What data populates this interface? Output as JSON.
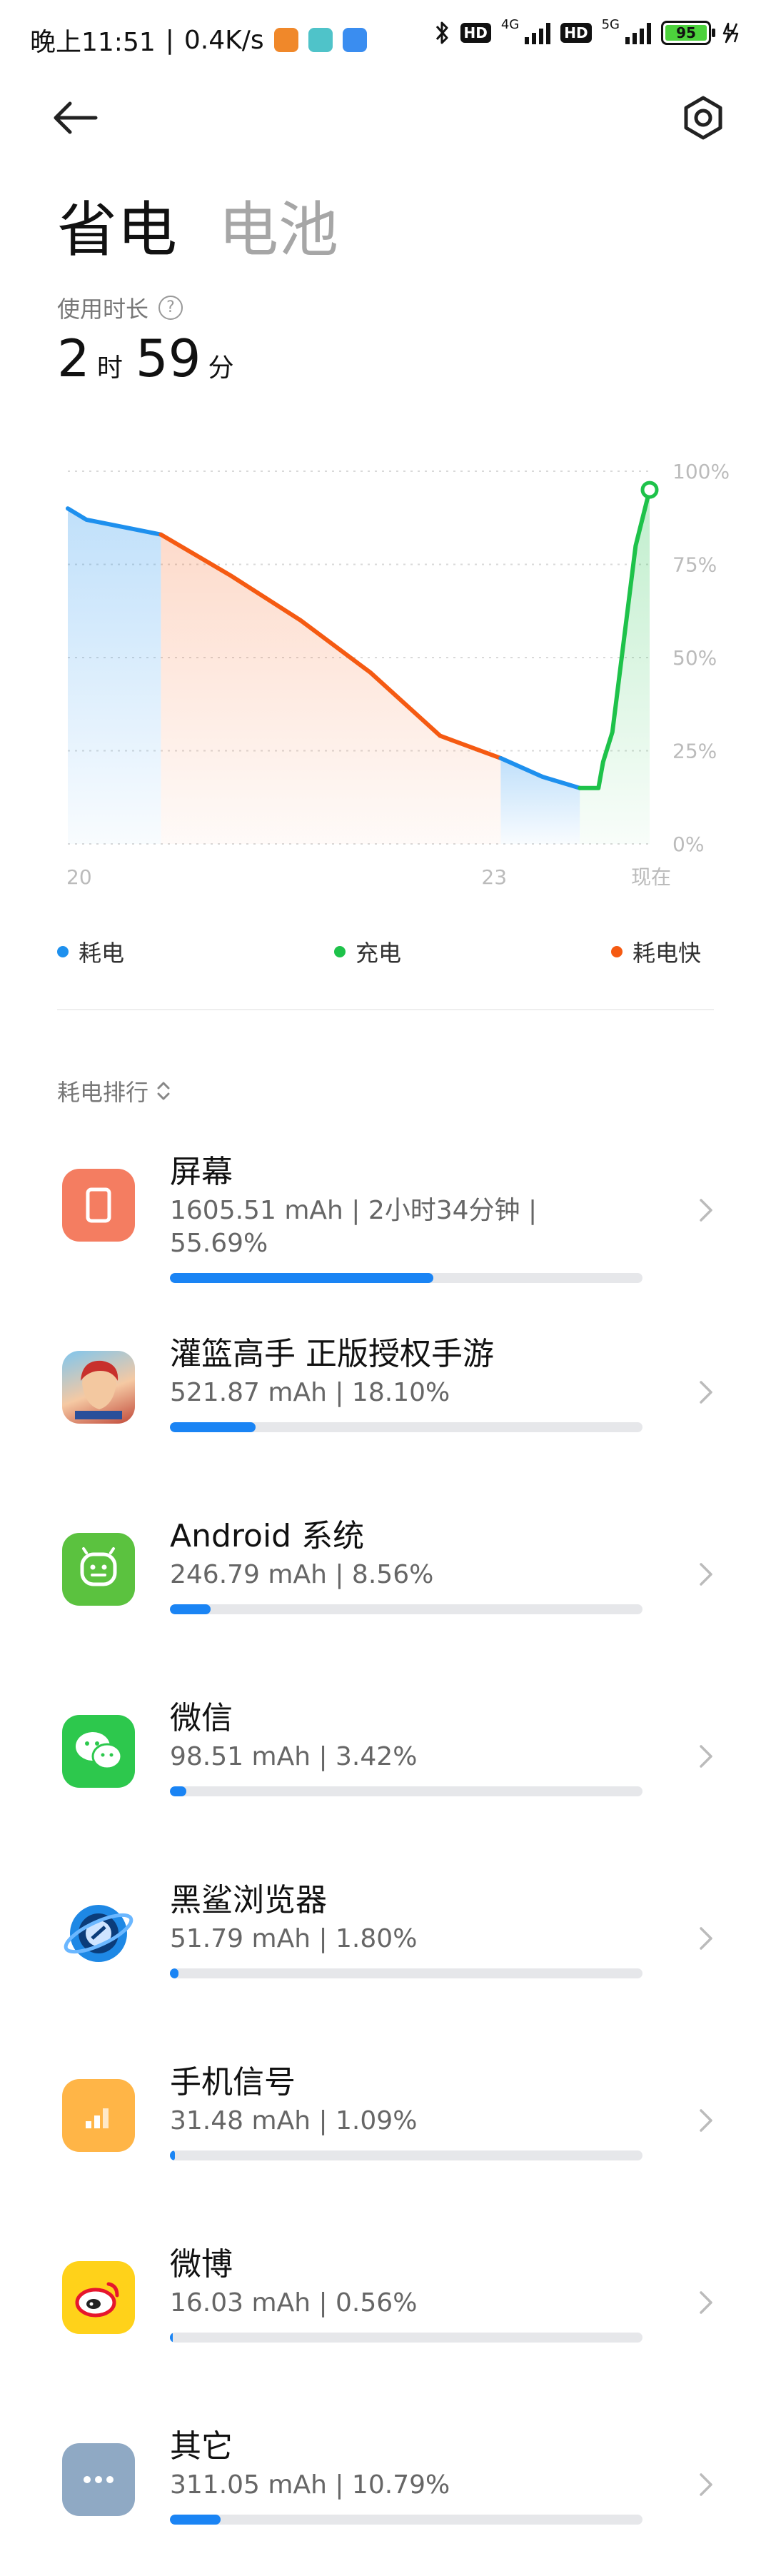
{
  "status": {
    "time": "晚上11:51",
    "speed": "0.4K/s",
    "net1": "4G",
    "net2": "5G",
    "hd": "HD",
    "battery": "95"
  },
  "header": {
    "tab_active": "省电",
    "tab_inactive": "电池"
  },
  "usage": {
    "label": "使用时长",
    "hours": "2",
    "hours_unit": "时",
    "minutes": "59",
    "minutes_unit": "分"
  },
  "chart_data": {
    "type": "line",
    "title": "",
    "x_ticks": [
      "20",
      "23",
      "现在"
    ],
    "y_ticks": [
      "100%",
      "75%",
      "50%",
      "25%",
      "0%"
    ],
    "ylim": [
      0,
      100
    ],
    "grid": true,
    "series": [
      {
        "name": "耗电",
        "color": "#1e90ee",
        "values": [
          [
            0,
            90
          ],
          [
            0.04,
            87
          ],
          [
            0.2,
            83
          ]
        ]
      },
      {
        "name": "耗电快",
        "color": "#f55a12",
        "values": [
          [
            0.2,
            83
          ],
          [
            0.35,
            72
          ],
          [
            0.5,
            60
          ],
          [
            0.65,
            46
          ],
          [
            0.8,
            29
          ],
          [
            0.93,
            23
          ]
        ]
      },
      {
        "name": "耗电",
        "color": "#1e90ee",
        "values": [
          [
            0.93,
            23
          ],
          [
            1.02,
            18
          ],
          [
            1.1,
            15
          ]
        ]
      },
      {
        "name": "充电",
        "color": "#1ec24a",
        "values": [
          [
            1.1,
            15
          ],
          [
            1.14,
            15
          ],
          [
            1.15,
            22
          ],
          [
            1.17,
            30
          ],
          [
            1.22,
            80
          ],
          [
            1.25,
            95
          ]
        ]
      }
    ]
  },
  "legend": {
    "drain": "耗电",
    "charge": "充电",
    "fast": "耗电快",
    "drain_color": "#1e90ee",
    "charge_color": "#1ec24a",
    "fast_color": "#f55a12"
  },
  "ranking": {
    "title": "耗电排行"
  },
  "apps": [
    {
      "name": "屏幕",
      "stats": "1605.51 mAh | 2小时34分钟 | 55.69%",
      "percent": 55.69,
      "icon": "screen-icon"
    },
    {
      "name": "灌篮高手 正版授权手游",
      "stats": "521.87 mAh | 18.10%",
      "percent": 18.1,
      "icon": "slam-dunk-game-icon"
    },
    {
      "name": "Android 系统",
      "stats": "246.79 mAh | 8.56%",
      "percent": 8.56,
      "icon": "android-icon"
    },
    {
      "name": "微信",
      "stats": "98.51 mAh | 3.42%",
      "percent": 3.42,
      "icon": "wechat-icon"
    },
    {
      "name": "黑鲨浏览器",
      "stats": "51.79 mAh | 1.80%",
      "percent": 1.8,
      "icon": "browser-icon"
    },
    {
      "name": "手机信号",
      "stats": "31.48 mAh | 1.09%",
      "percent": 1.09,
      "icon": "signal-icon"
    },
    {
      "name": "微博",
      "stats": "16.03 mAh | 0.56%",
      "percent": 0.56,
      "icon": "weibo-icon"
    },
    {
      "name": "其它",
      "stats": "311.05 mAh | 10.79%",
      "percent": 10.79,
      "icon": "more-icon"
    }
  ]
}
